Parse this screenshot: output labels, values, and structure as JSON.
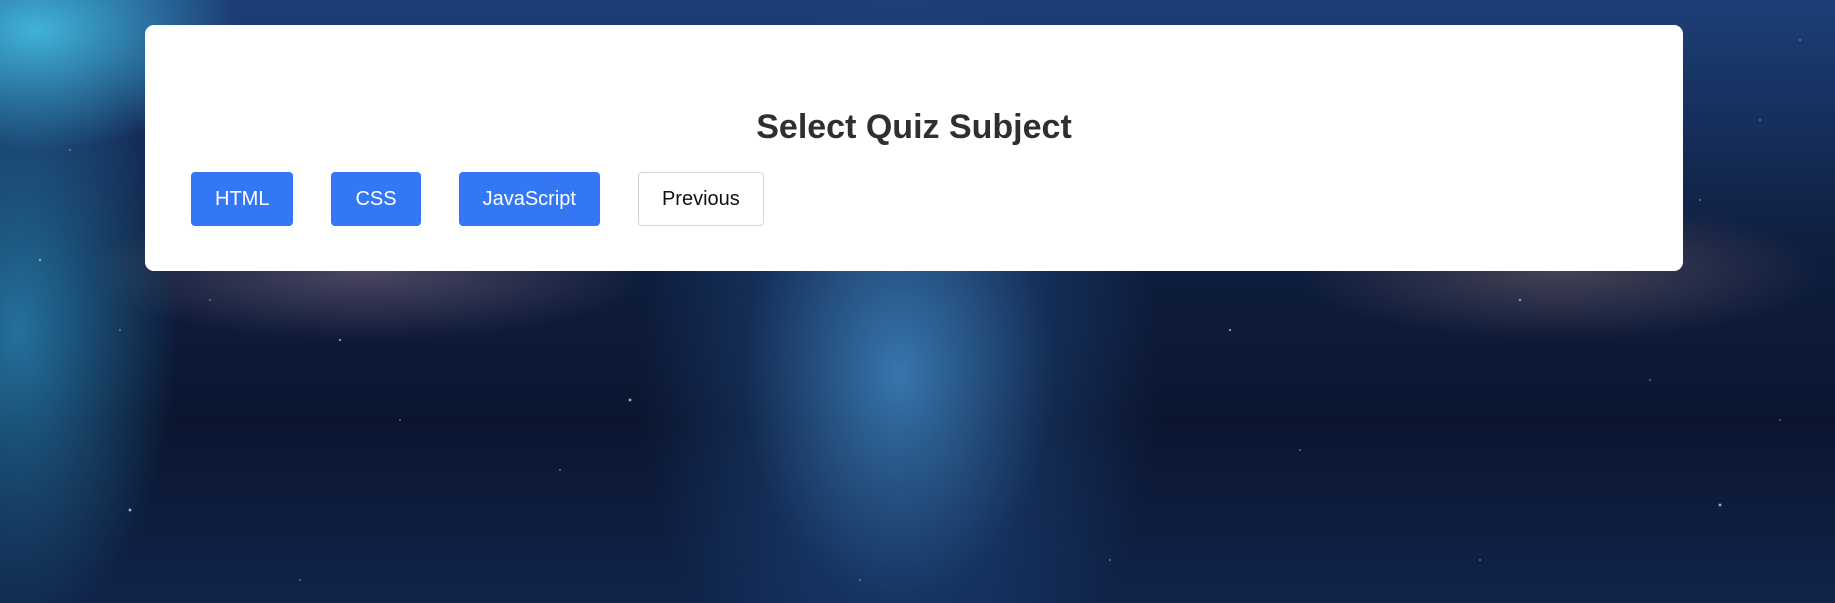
{
  "quiz": {
    "title": "Select Quiz Subject",
    "subjects": [
      "HTML",
      "CSS",
      "JavaScript"
    ],
    "previous_label": "Previous"
  },
  "colors": {
    "accent": "#3477f5",
    "panel_bg": "#ffffff",
    "title_text": "#2f2f2f"
  }
}
